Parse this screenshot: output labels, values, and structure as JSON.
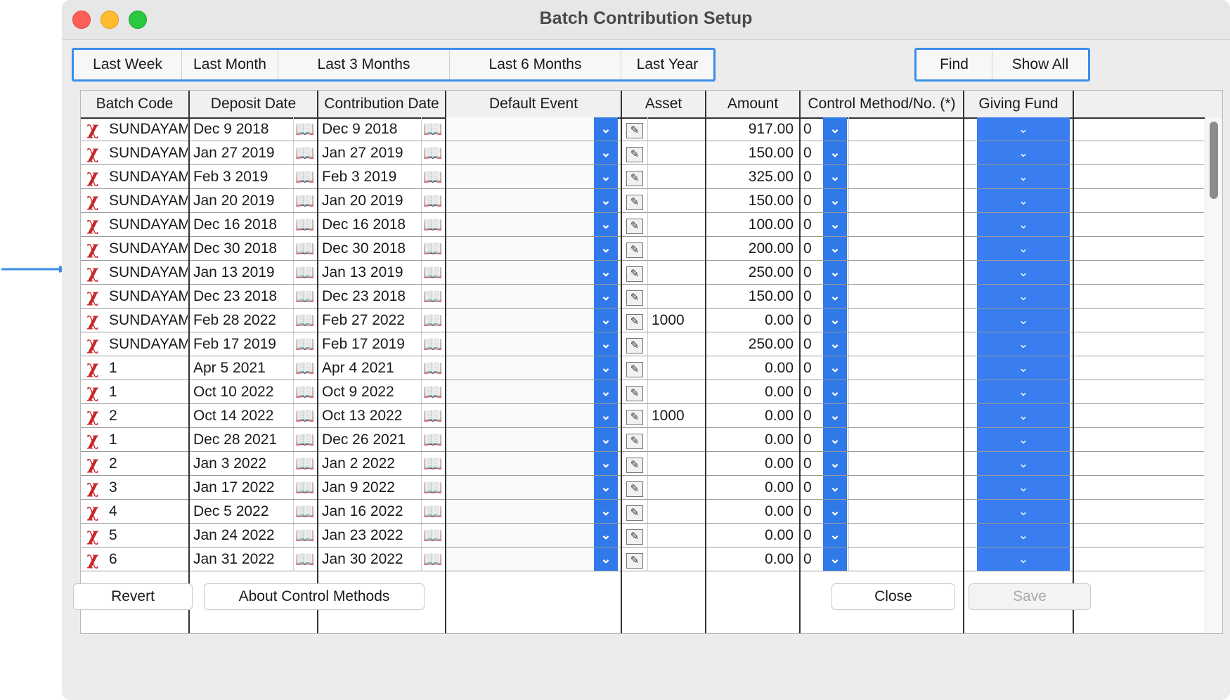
{
  "window": {
    "title": "Batch Contribution Setup"
  },
  "date_filters": [
    "Last Week",
    "Last Month",
    "Last 3 Months",
    "Last 6 Months",
    "Last Year"
  ],
  "search": {
    "find_label": "Find",
    "show_all_label": "Show All"
  },
  "columns": {
    "batch_code": "Batch Code",
    "deposit_date": "Deposit Date",
    "contribution_date": "Contribution Date",
    "default_event": "Default Event",
    "asset": "Asset",
    "amount": "Amount",
    "control_method": "Control Method/No. (*)",
    "giving_fund": "Giving Fund"
  },
  "rows": [
    {
      "code": "SUNDAYAM",
      "deposit": "Dec 9 2018",
      "contribution": "Dec 9 2018",
      "asset": "",
      "amount": "917.00",
      "control": "0"
    },
    {
      "code": "SUNDAYAM",
      "deposit": "Jan 27 2019",
      "contribution": "Jan 27 2019",
      "asset": "",
      "amount": "150.00",
      "control": "0"
    },
    {
      "code": "SUNDAYAM",
      "deposit": "Feb 3 2019",
      "contribution": "Feb 3 2019",
      "asset": "",
      "amount": "325.00",
      "control": "0"
    },
    {
      "code": "SUNDAYAM",
      "deposit": "Jan 20 2019",
      "contribution": "Jan 20 2019",
      "asset": "",
      "amount": "150.00",
      "control": "0"
    },
    {
      "code": "SUNDAYAM",
      "deposit": "Dec 16 2018",
      "contribution": "Dec 16 2018",
      "asset": "",
      "amount": "100.00",
      "control": "0"
    },
    {
      "code": "SUNDAYAM",
      "deposit": "Dec 30 2018",
      "contribution": "Dec 30 2018",
      "asset": "",
      "amount": "200.00",
      "control": "0"
    },
    {
      "code": "SUNDAYAM",
      "deposit": "Jan 13 2019",
      "contribution": "Jan 13 2019",
      "asset": "",
      "amount": "250.00",
      "control": "0"
    },
    {
      "code": "SUNDAYAM",
      "deposit": "Dec 23 2018",
      "contribution": "Dec 23 2018",
      "asset": "",
      "amount": "150.00",
      "control": "0"
    },
    {
      "code": "SUNDAYAM",
      "deposit": "Feb 28 2022",
      "contribution": "Feb 27 2022",
      "asset": "1000",
      "amount": "0.00",
      "control": "0"
    },
    {
      "code": "SUNDAYAM",
      "deposit": "Feb 17 2019",
      "contribution": "Feb 17 2019",
      "asset": "",
      "amount": "250.00",
      "control": "0"
    },
    {
      "code": "1",
      "deposit": "Apr 5 2021",
      "contribution": "Apr 4 2021",
      "asset": "",
      "amount": "0.00",
      "control": "0"
    },
    {
      "code": "1",
      "deposit": "Oct 10 2022",
      "contribution": "Oct 9 2022",
      "asset": "",
      "amount": "0.00",
      "control": "0"
    },
    {
      "code": "2",
      "deposit": "Oct 14 2022",
      "contribution": "Oct 13 2022",
      "asset": "1000",
      "amount": "0.00",
      "control": "0"
    },
    {
      "code": "1",
      "deposit": "Dec 28 2021",
      "contribution": "Dec 26 2021",
      "asset": "",
      "amount": "0.00",
      "control": "0"
    },
    {
      "code": "2",
      "deposit": "Jan 3 2022",
      "contribution": "Jan 2 2022",
      "asset": "",
      "amount": "0.00",
      "control": "0"
    },
    {
      "code": "3",
      "deposit": "Jan 17 2022",
      "contribution": "Jan 9 2022",
      "asset": "",
      "amount": "0.00",
      "control": "0"
    },
    {
      "code": "4",
      "deposit": "Dec 5 2022",
      "contribution": "Jan 16 2022",
      "asset": "",
      "amount": "0.00",
      "control": "0"
    },
    {
      "code": "5",
      "deposit": "Jan 24 2022",
      "contribution": "Jan 23 2022",
      "asset": "",
      "amount": "0.00",
      "control": "0"
    },
    {
      "code": "6",
      "deposit": "Jan 31 2022",
      "contribution": "Jan 30 2022",
      "asset": "",
      "amount": "0.00",
      "control": "0"
    }
  ],
  "footer": {
    "revert_label": "Revert",
    "about_label": "About Control Methods",
    "close_label": "Close",
    "save_label": "Save"
  },
  "icons": {
    "delete": "delete-x-icon",
    "calendar": "calendar-book-icon",
    "dropdown": "chevron-down-icon",
    "edit": "edit-note-icon",
    "pointer": "arrow-right-icon"
  },
  "colors": {
    "accent": "#3b8ee8",
    "dropdown_blue": "#2f79e8",
    "delete_red": "#c62828"
  }
}
